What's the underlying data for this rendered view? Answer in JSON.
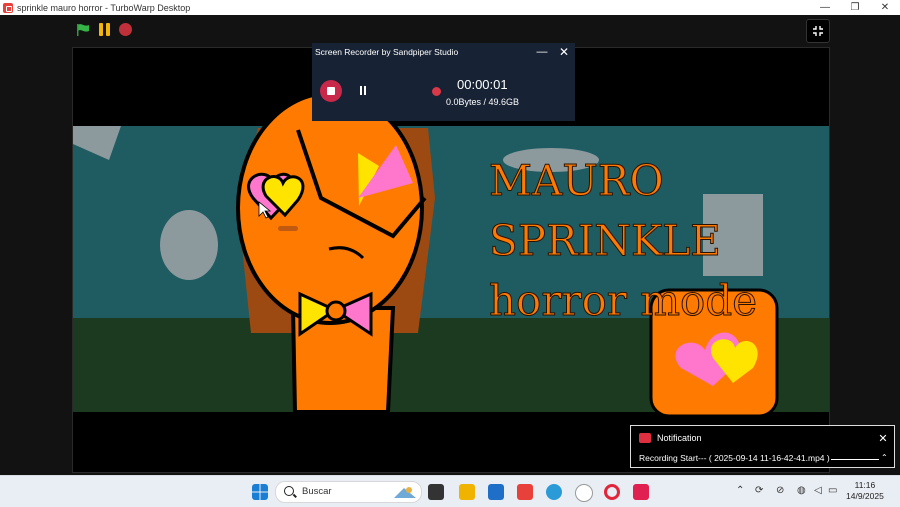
{
  "window": {
    "title": "sprinkle mauro horror - TurboWarp Desktop",
    "minimize": "—",
    "maximize": "❐",
    "close": "✕"
  },
  "toolbar": {
    "green_flag_icon": "green-flag-icon",
    "pause_icon": "pause-icon",
    "stop_icon": "stop-icon",
    "fullscreen_icon": "exit-fullscreen-icon"
  },
  "stage": {
    "line1": "MAURO",
    "line2": "SPRINKLE",
    "line3": "horror  mode"
  },
  "recorder": {
    "title": "Screen Recorder by Sandpiper Studio",
    "minimize": "—",
    "close": "✕",
    "elapsed": "00:00:01",
    "size": "0.0Bytes / 49.6GB"
  },
  "notification": {
    "title": "Notification",
    "message": "Recording Start--- ( 2025-09-14 11-16-42-41.mp4 )",
    "close": "✕",
    "expand": "⌃"
  },
  "taskbar": {
    "search_placeholder": "Buscar",
    "tray_overflow": "⌃",
    "time": "11:16",
    "date": "14/9/2025"
  },
  "colors": {
    "stage_orange": "#ff7a00",
    "sky_teal": "#1f5c62",
    "ground_green": "#1c3a1f",
    "recorder_bg": "#172234",
    "accent_red": "#c8284a"
  }
}
